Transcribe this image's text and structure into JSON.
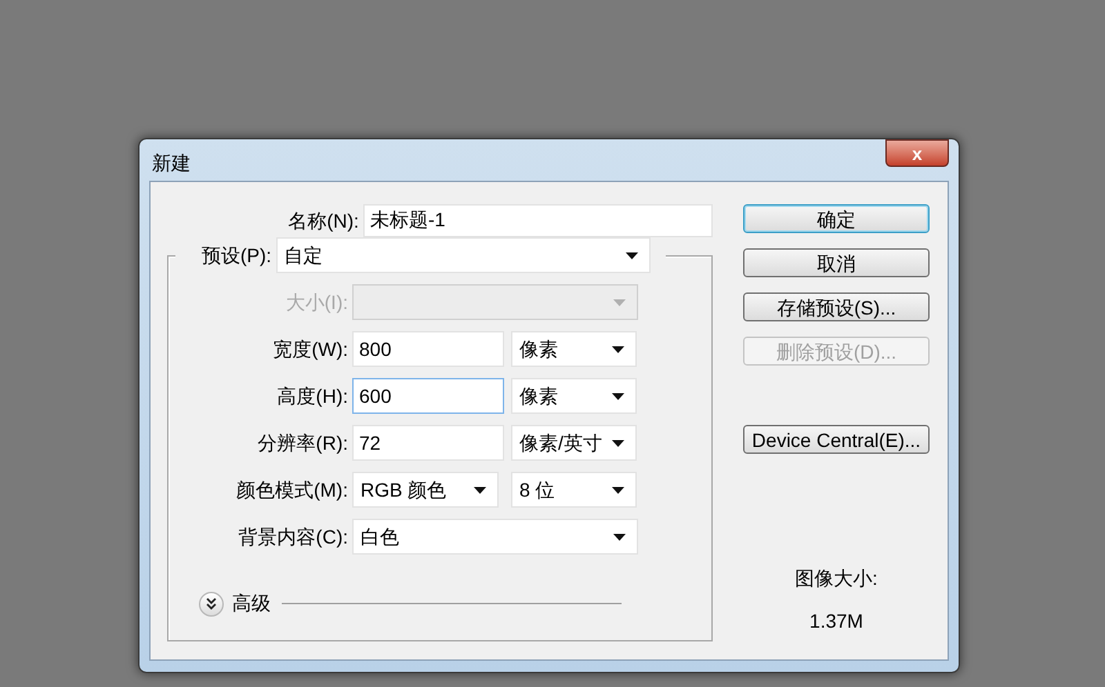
{
  "window": {
    "title": "新建",
    "close": "x"
  },
  "name": {
    "label": "名称(N):",
    "value": "未标题-1"
  },
  "preset": {
    "label": "预设(P):",
    "value": "自定"
  },
  "rows": [
    {
      "kind": "size",
      "label": "大小(I):",
      "disabled": true
    },
    {
      "kind": "field",
      "label": "宽度(W):",
      "value": "800",
      "focused": false,
      "unit": "像素"
    },
    {
      "kind": "field",
      "label": "高度(H):",
      "value": "600",
      "focused": true,
      "unit": "像素"
    },
    {
      "kind": "field",
      "label": "分辨率(R):",
      "value": "72",
      "focused": false,
      "unit": "像素/英寸"
    },
    {
      "kind": "pair",
      "label": "颜色模式(M):",
      "value": "RGB 颜色",
      "unit": "8 位"
    },
    {
      "kind": "wide",
      "label": "背景内容(C):",
      "value": "白色"
    }
  ],
  "advanced": {
    "label": "高级",
    "expanded": false
  },
  "buttons": [
    {
      "label": "确定",
      "default": true,
      "disabled": false
    },
    {
      "label": "取消",
      "default": false,
      "disabled": false
    },
    {
      "label": "存储预设(S)...",
      "default": false,
      "disabled": false
    },
    {
      "label": "删除预设(D)...",
      "default": false,
      "disabled": true
    },
    {
      "label": "Device Central(E)...",
      "default": false,
      "disabled": false
    }
  ],
  "info": {
    "label": "图像大小:",
    "value": "1.37M"
  }
}
